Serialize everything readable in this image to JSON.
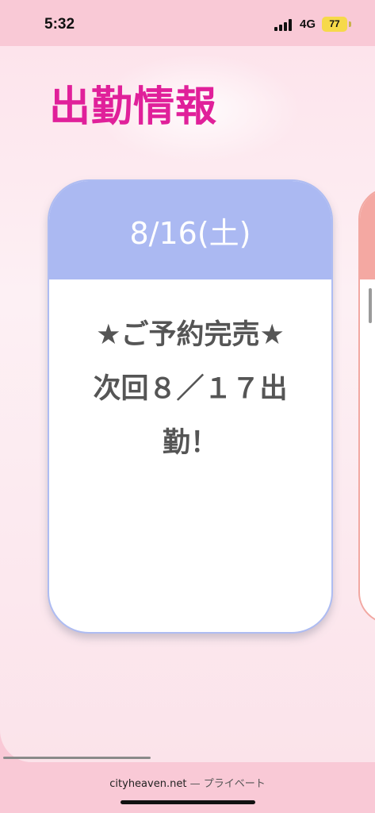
{
  "status_bar": {
    "time": "5:32",
    "network": "4G",
    "battery": "77"
  },
  "page": {
    "heading": "出勤情報",
    "card": {
      "date": "8/16(土)",
      "lines": [
        "★ご予約完売★",
        "次回８／１７出",
        "勤！"
      ]
    }
  },
  "browser": {
    "domain": "cityheaven.net",
    "separator": "—",
    "mode": "プライベート"
  },
  "colors": {
    "heading": "#e0209a",
    "card_header": "#abb9f2",
    "next_card_header": "#f4a8a2",
    "status_bar": "#f9c9d6"
  }
}
